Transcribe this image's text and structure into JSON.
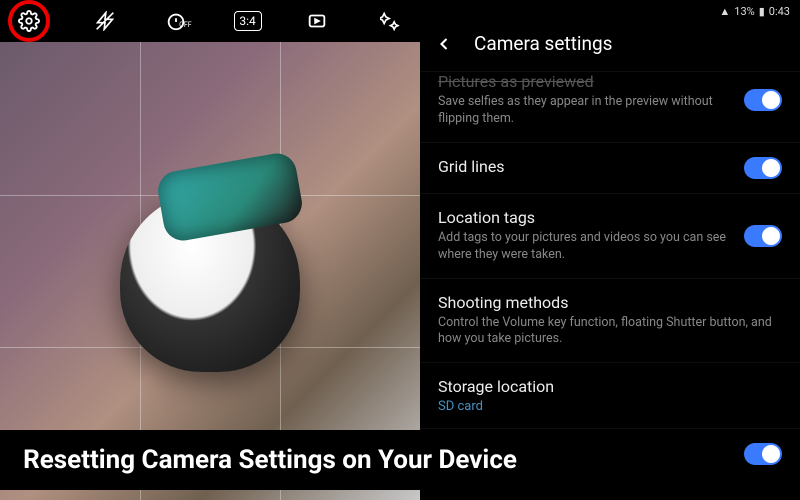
{
  "camera": {
    "toolbar_icons": {
      "settings": "gear-icon",
      "flash": "flash-off-icon",
      "timer": "timer-off-icon",
      "ratio": "3:4",
      "motion": "motion-photo-icon",
      "effects": "effects-icon"
    }
  },
  "status": {
    "battery": "13%",
    "time": "0:43"
  },
  "header": {
    "title": "Camera settings"
  },
  "settings": [
    {
      "title": "Pictures as previewed",
      "subtitle": "Save selfies as they appear in the preview without flipping them.",
      "toggle": true
    },
    {
      "title": "Grid lines",
      "subtitle": "",
      "toggle": true
    },
    {
      "title": "Location tags",
      "subtitle": "Add tags to your pictures and videos so you can see where they were taken.",
      "toggle": true
    },
    {
      "title": "Shooting methods",
      "subtitle": "Control the Volume key function, floating Shutter button, and how you take pictures.",
      "toggle": false
    },
    {
      "title": "Storage location",
      "subtitle": "",
      "link": "SD card",
      "toggle": false
    }
  ],
  "caption": "Resetting Camera Settings on Your Device"
}
